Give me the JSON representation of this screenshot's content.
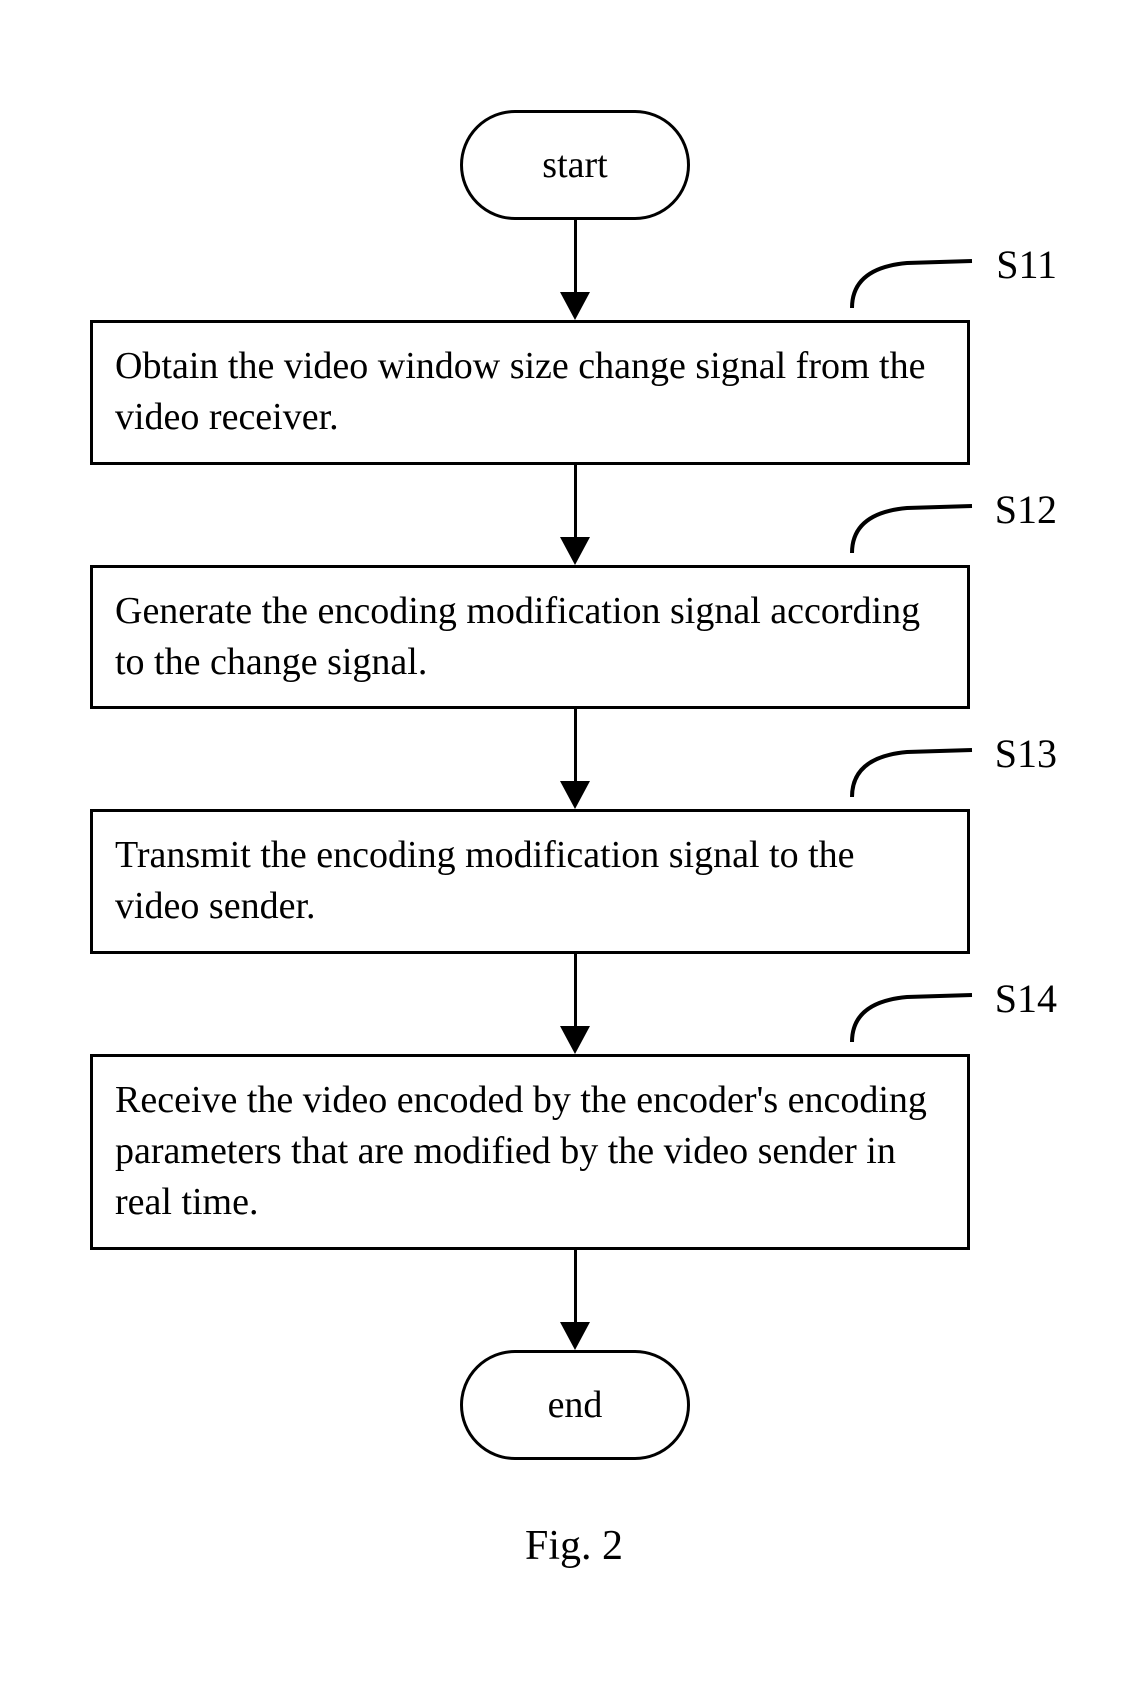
{
  "flowchart": {
    "start": "start",
    "end": "end",
    "steps": [
      {
        "label": "S11",
        "text": "Obtain the video window size change signal from the video receiver."
      },
      {
        "label": "S12",
        "text": "Generate the encoding modification signal according to the change signal."
      },
      {
        "label": "S13",
        "text": "Transmit the encoding modification signal to the video sender."
      },
      {
        "label": "S14",
        "text": "Receive the video encoded by the encoder's encoding parameters that are modified by the video sender in real time."
      }
    ]
  },
  "caption": "Fig. 2"
}
